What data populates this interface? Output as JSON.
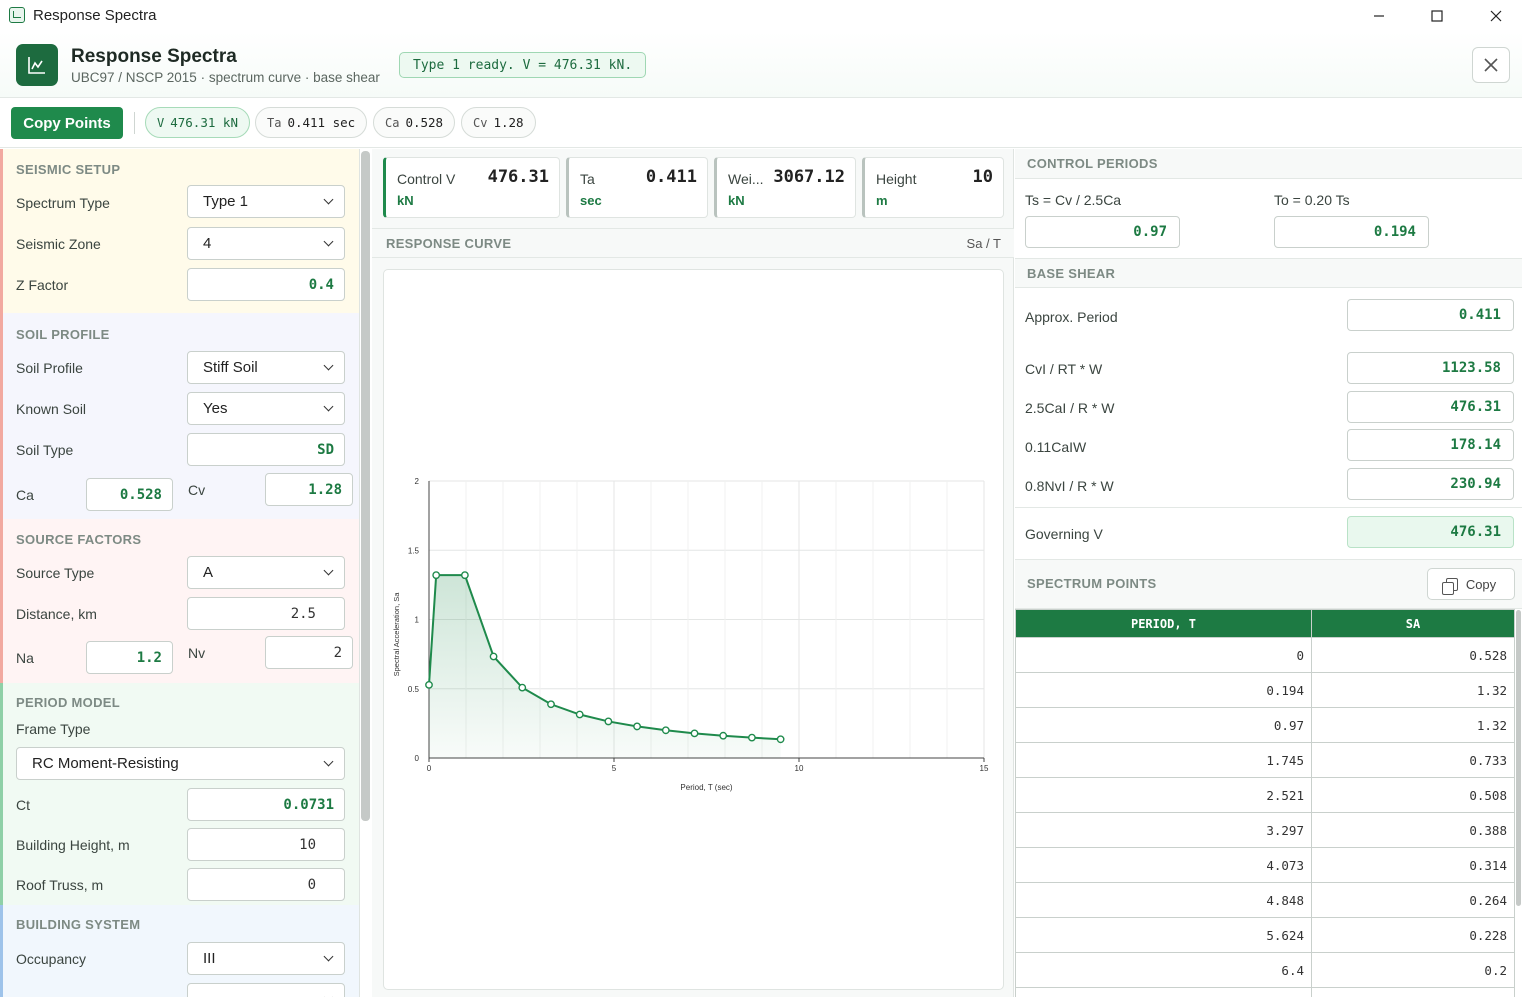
{
  "window": {
    "title": "Response Spectra"
  },
  "header": {
    "title": "Response Spectra",
    "subtitle": "UBC97 / NSCP 2015 · spectrum curve · base shear",
    "status": "Type 1 ready. V = 476.31 kN."
  },
  "toolbar": {
    "copy_points_label": "Copy Points",
    "chips": [
      {
        "label": "V",
        "value": "476.31 kN"
      },
      {
        "label": "Ta",
        "value": "0.411 sec"
      },
      {
        "label": "Ca",
        "value": "0.528"
      },
      {
        "label": "Cv",
        "value": "1.28"
      }
    ]
  },
  "left": {
    "seismic": {
      "title": "SEISMIC SETUP",
      "spectrum_type_label": "Spectrum Type",
      "spectrum_type": "Type 1",
      "seismic_zone_label": "Seismic Zone",
      "seismic_zone": "4",
      "z_factor_label": "Z Factor",
      "z_factor": "0.4"
    },
    "soil": {
      "title": "SOIL PROFILE",
      "soil_profile_label": "Soil Profile",
      "soil_profile": "Stiff Soil",
      "known_soil_label": "Known Soil",
      "known_soil": "Yes",
      "soil_type_label": "Soil Type",
      "soil_type": "SD",
      "ca_label": "Ca",
      "ca": "0.528",
      "cv_label": "Cv",
      "cv": "1.28"
    },
    "source": {
      "title": "SOURCE FACTORS",
      "source_type_label": "Source Type",
      "source_type": "A",
      "distance_label": "Distance, km",
      "distance": "2.5",
      "na_label": "Na",
      "na": "1.2",
      "nv_label": "Nv",
      "nv": "2"
    },
    "period": {
      "title": "PERIOD MODEL",
      "frame_type_label": "Frame Type",
      "frame_type": "RC Moment-Resisting",
      "ct_label": "Ct",
      "ct": "0.0731",
      "height_label": "Building Height, m",
      "height": "10",
      "roof_label": "Roof Truss, m",
      "roof": "0"
    },
    "building": {
      "title": "BUILDING SYSTEM",
      "occupancy_label": "Occupancy",
      "occupancy": "III"
    }
  },
  "kpis": [
    {
      "label": "Control V",
      "value": "476.31",
      "unit": "kN"
    },
    {
      "label": "Ta",
      "value": "0.411",
      "unit": "sec"
    },
    {
      "label": "Wei...",
      "value": "3067.12",
      "unit": "kN"
    },
    {
      "label": "Height",
      "value": "10",
      "unit": "m"
    }
  ],
  "response_curve": {
    "title": "RESPONSE CURVE",
    "unit": "Sa / T"
  },
  "chart_data": {
    "type": "area",
    "xlabel": "Period, T (sec)",
    "ylabel": "Spectral Acceleration, Sa",
    "xlim": [
      0,
      15
    ],
    "ylim": [
      0,
      2
    ],
    "x_ticks": [
      "0",
      "5",
      "10",
      "15"
    ],
    "y_ticks": [
      "0",
      "0.5",
      "1",
      "1.5",
      "2"
    ],
    "grid": true,
    "x": [
      0,
      0.194,
      0.97,
      1.745,
      2.521,
      3.297,
      4.073,
      4.848,
      5.624,
      6.4,
      7.176,
      7.951,
      8.727,
      9.503
    ],
    "y": [
      0.528,
      1.32,
      1.32,
      0.733,
      0.508,
      0.388,
      0.314,
      0.264,
      0.228,
      0.2,
      0.178,
      0.161,
      0.147,
      0.135
    ],
    "color": "#1f8a4c"
  },
  "right": {
    "control_periods": {
      "title": "CONTROL PERIODS",
      "ts_label": "Ts = Cv / 2.5Ca",
      "ts": "0.97",
      "to_label": "To = 0.20 Ts",
      "to": "0.194"
    },
    "base_shear": {
      "title": "BASE SHEAR",
      "rows": [
        {
          "label": "Approx. Period",
          "value": "0.411"
        },
        {
          "label": "CvI / RT * W",
          "value": "1123.58"
        },
        {
          "label": "2.5CaI / R * W",
          "value": "476.31"
        },
        {
          "label": "0.11CaIW",
          "value": "178.14"
        },
        {
          "label": "0.8NvI / R * W",
          "value": "230.94"
        }
      ],
      "governing_label": "Governing V",
      "governing": "476.31"
    },
    "spectrum_points": {
      "title": "SPECTRUM POINTS",
      "copy_label": "Copy",
      "columns": [
        "PERIOD, T",
        "SA"
      ],
      "rows": [
        [
          "0",
          "0.528"
        ],
        [
          "0.194",
          "1.32"
        ],
        [
          "0.97",
          "1.32"
        ],
        [
          "1.745",
          "0.733"
        ],
        [
          "2.521",
          "0.508"
        ],
        [
          "3.297",
          "0.388"
        ],
        [
          "4.073",
          "0.314"
        ],
        [
          "4.848",
          "0.264"
        ],
        [
          "5.624",
          "0.228"
        ],
        [
          "6.4",
          "0.2"
        ]
      ]
    }
  }
}
